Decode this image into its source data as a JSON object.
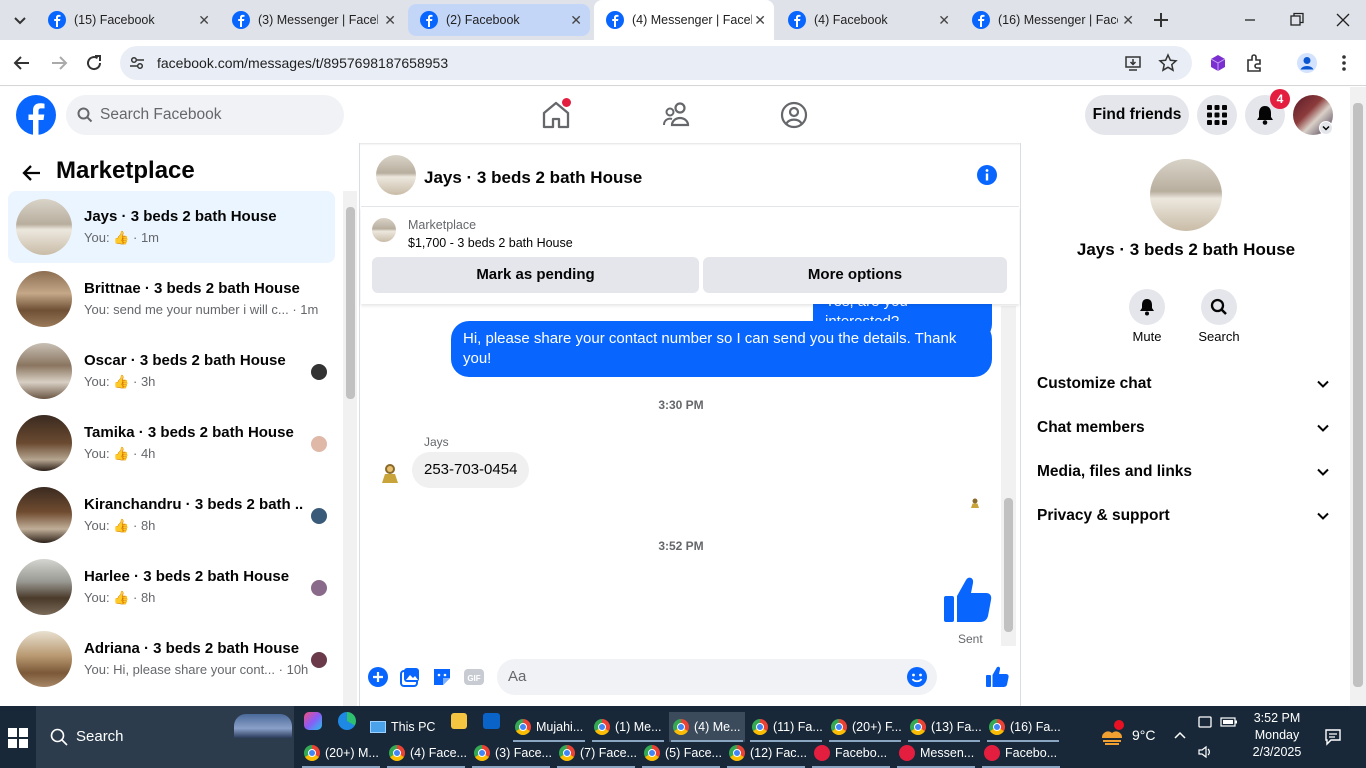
{
  "browser": {
    "tabs": [
      {
        "title": "(15) Facebook",
        "icon": "facebook-icon"
      },
      {
        "title": "(3) Messenger | Faceb",
        "icon": "messenger-icon"
      },
      {
        "title": "(2) Facebook",
        "icon": "facebook-icon"
      },
      {
        "title": "(4) Messenger | Faceb",
        "icon": "messenger-icon"
      },
      {
        "title": "(4) Facebook",
        "icon": "facebook-icon"
      },
      {
        "title": "(16) Messenger | Face",
        "icon": "messenger-icon"
      }
    ],
    "url": "facebook.com/messages/t/8957698187658953"
  },
  "header": {
    "search_placeholder": "Search Facebook",
    "find_friends": "Find friends",
    "notification_count": "4"
  },
  "sidebar": {
    "title": "Marketplace",
    "conversations": [
      {
        "name": "Jays · 3 beds 2 bath House",
        "preview": "You:",
        "time": "· 1m",
        "liked": true
      },
      {
        "name": "Brittnae · 3 beds 2 bath House",
        "preview": "You: send me your number i will c...",
        "time": "· 1m",
        "liked": false
      },
      {
        "name": "Oscar · 3 beds 2 bath House",
        "preview": "You:",
        "time": "· 3h",
        "liked": true
      },
      {
        "name": "Tamika · 3 beds 2 bath House",
        "preview": "You:",
        "time": "· 4h",
        "liked": true
      },
      {
        "name": "Kiranchandru · 3 beds 2 bath ...",
        "preview": "You:",
        "time": "· 8h",
        "liked": true
      },
      {
        "name": "Harlee · 3 beds 2 bath House",
        "preview": "You:",
        "time": "· 8h",
        "liked": true
      },
      {
        "name": "Adriana · 3 beds 2 bath House",
        "preview": "You: Hi, please share your cont...",
        "time": "· 10h",
        "liked": false
      }
    ]
  },
  "chat": {
    "title": "Jays · 3 beds 2 bath House",
    "marketplace_label": "Marketplace",
    "listing": "$1,700 - 3 beds 2 bath House",
    "mark_pending": "Mark as pending",
    "more_options": "More options",
    "partial_msg": "Yes, are you interested?",
    "outgoing_msg": "Hi, please share your contact number so I can send you the details. Thank you!",
    "time1": "3:30 PM",
    "sender": "Jays",
    "incoming_msg": "253-703-0454",
    "time2": "3:52 PM",
    "status": "Sent",
    "input_placeholder": "Aa"
  },
  "details": {
    "name": "Jays · 3 beds 2 bath House",
    "mute": "Mute",
    "search": "Search",
    "sections": [
      "Customize chat",
      "Chat members",
      "Media, files and links",
      "Privacy & support"
    ]
  },
  "taskbar": {
    "search": "Search",
    "top_row": [
      "This PC",
      "Mujahi...",
      "(1) Me...",
      "(4) Me...",
      "(11) Fa...",
      "(20+) F...",
      "(13) Fa...",
      "(16) Fa..."
    ],
    "bottom_row": [
      "(20+) M...",
      "(4) Face...",
      "(3) Face...",
      "(7) Face...",
      "(5) Face...",
      "(12) Fac...",
      "Facebo...",
      "Messen...",
      "Facebo..."
    ],
    "weather": "9°C",
    "time": "3:52 PM",
    "day": "Monday",
    "date": "2/3/2025"
  },
  "colors": {
    "fb_blue": "#0866ff",
    "accent_selected": "#ebf5ff",
    "taskbar": "#182838"
  }
}
